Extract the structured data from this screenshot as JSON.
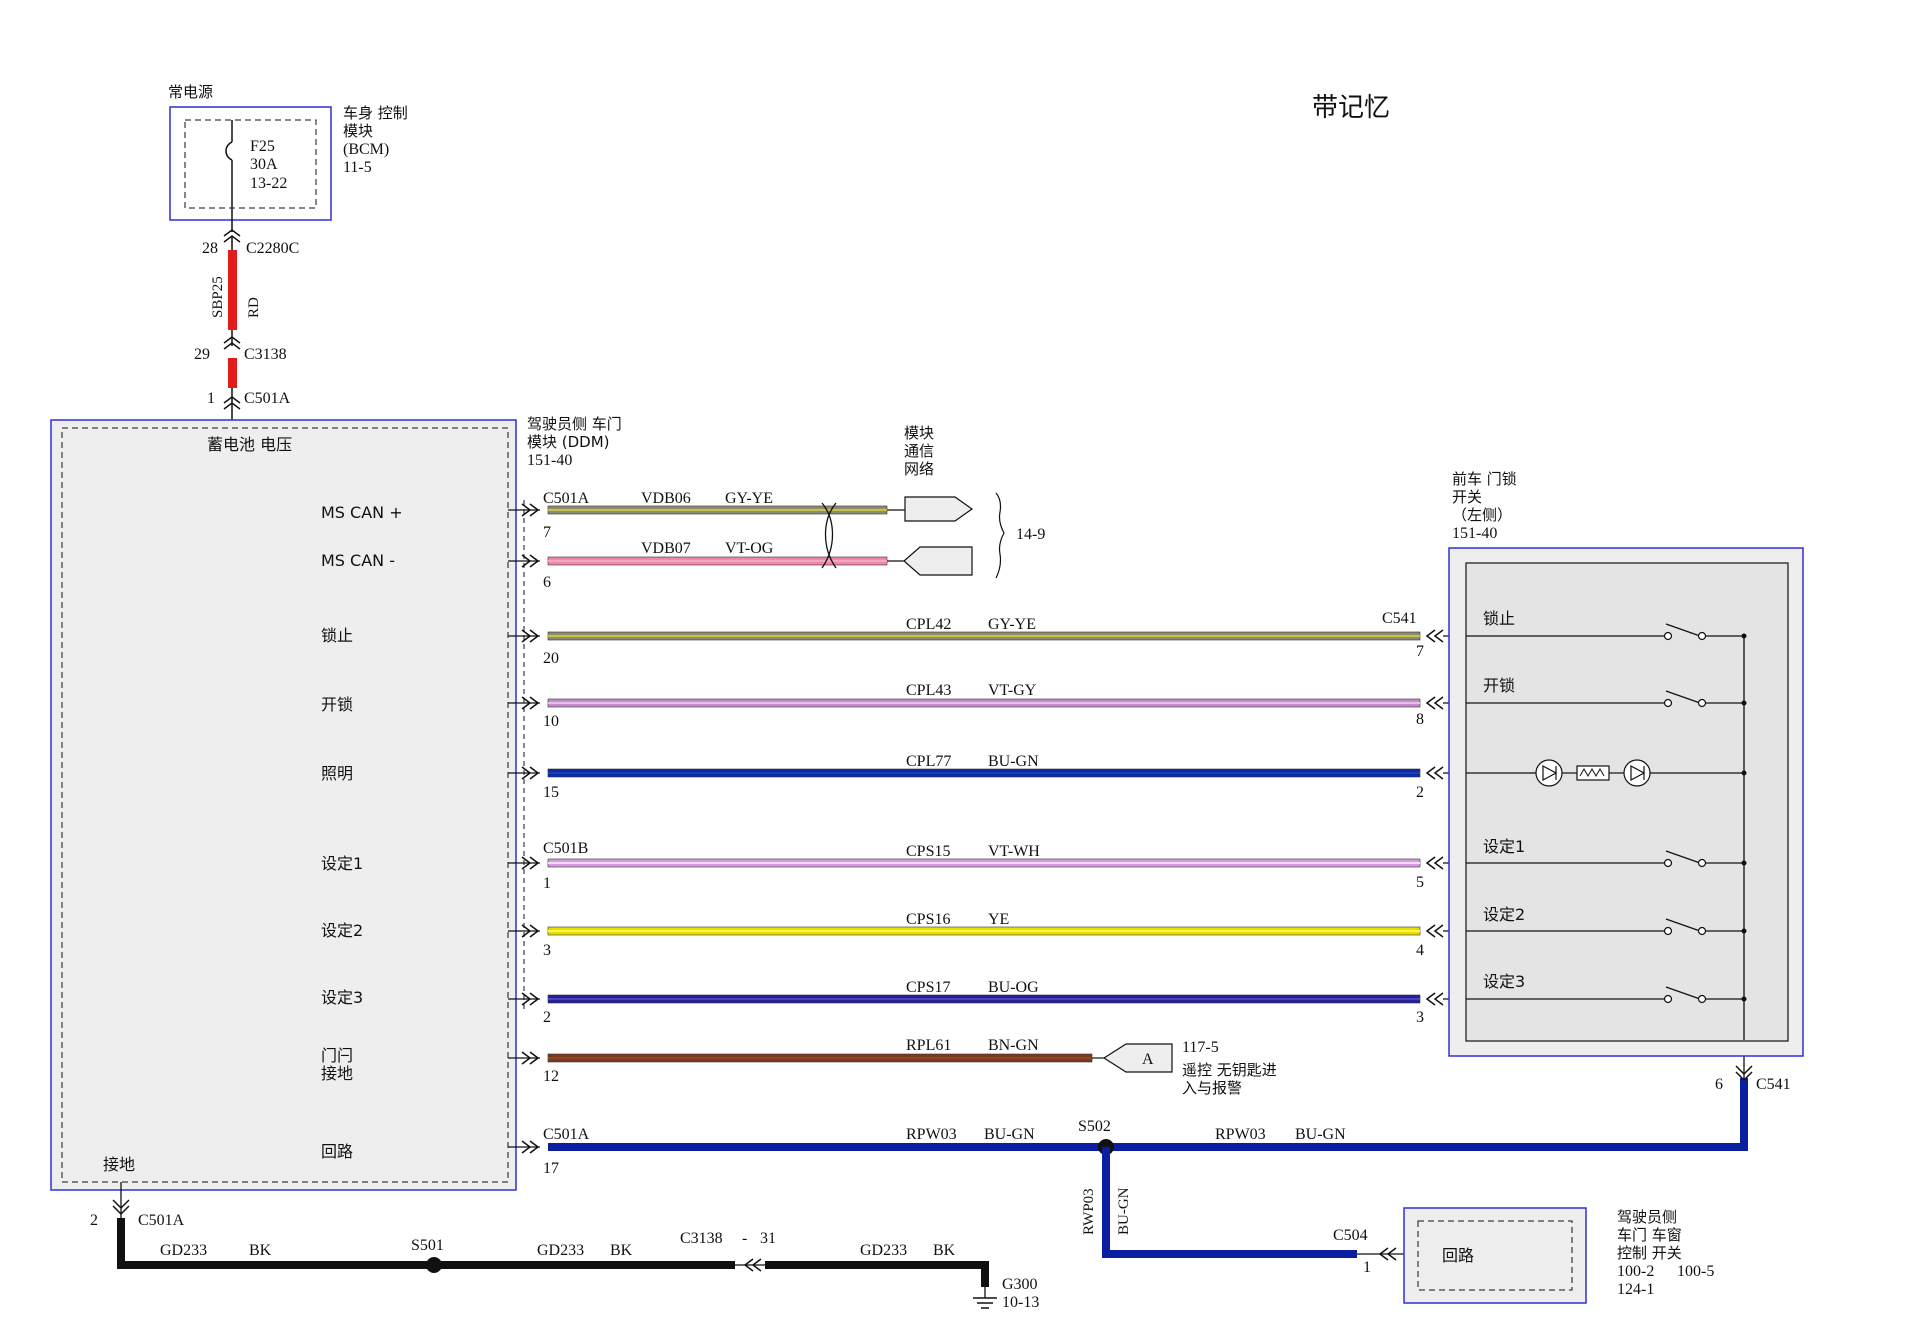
{
  "title": "带记忆",
  "colors": {
    "border": "#2e2edc",
    "box_fill": "#eeeeee",
    "inner_fill": "#e4e4e4",
    "red": "#e31b1b",
    "blue": "#0a1ea0",
    "black": "#111111",
    "gy_ye": [
      "#8c8c6e",
      "#c9c24a"
    ],
    "vt_og": [
      "#ee8aa8",
      "#f3a8c0"
    ],
    "vt_gy": [
      "#c58ac9",
      "#e2c4e6"
    ],
    "bu_gn": [
      "#0b2aa6",
      "#1a3fb8"
    ],
    "vt_wh": [
      "#d79be0",
      "#f2dcf5"
    ],
    "ye": [
      "#e6e000",
      "#fff544"
    ],
    "bu_og": [
      "#22209a",
      "#4d3fb8"
    ],
    "bn_gn": [
      "#7a3a1e",
      "#8a4a2a"
    ]
  },
  "power": {
    "label": "常电源",
    "fuse_name": "F25",
    "fuse_rating": "30A",
    "fuse_ref": "13-22",
    "bcm_line1": "车身 控制",
    "bcm_line2": "模块",
    "bcm_line3": "(BCM)",
    "bcm_ref": "11-5",
    "pin_top": "28",
    "conn_top": "C2280C",
    "wire_name": "SBP25",
    "wire_color": "RD",
    "pin_mid": "29",
    "conn_mid": "C3138",
    "pin_bottom": "1",
    "conn_bottom": "C501A"
  },
  "ddm": {
    "name_line1": "驾驶员侧 车门",
    "name_line2": "模块 (DDM)",
    "ref": "151-40",
    "battery_label": "蓄电池 电压",
    "ground_label": "接地",
    "pins": [
      {
        "label": "MS CAN +",
        "pin": "7",
        "conn": "C501A",
        "wire": "VDB06",
        "color": "GY-YE"
      },
      {
        "label": "MS CAN -",
        "pin": "6",
        "conn": "",
        "wire": "VDB07",
        "color": "VT-OG"
      },
      {
        "label": "锁止",
        "pin": "20",
        "conn": "",
        "wire": "CPL42",
        "color": "GY-YE",
        "far_pin": "7",
        "far_conn": "C541"
      },
      {
        "label": "开锁",
        "pin": "10",
        "conn": "",
        "wire": "CPL43",
        "color": "VT-GY",
        "far_pin": "8"
      },
      {
        "label": "照明",
        "pin": "15",
        "conn": "",
        "wire": "CPL77",
        "color": "BU-GN",
        "far_pin": "2"
      },
      {
        "label": "设定1",
        "pin": "1",
        "conn": "C501B",
        "wire": "CPS15",
        "color": "VT-WH",
        "far_pin": "5"
      },
      {
        "label": "设定2",
        "pin": "3",
        "conn": "",
        "wire": "CPS16",
        "color": "YE",
        "far_pin": "4"
      },
      {
        "label": "设定3",
        "pin": "2",
        "conn": "",
        "wire": "CPS17",
        "color": "BU-OG",
        "far_pin": "3"
      },
      {
        "label_line1": "门闩",
        "label_line2": "接地",
        "pin": "12",
        "wire": "RPL61",
        "color": "BN-GN"
      },
      {
        "label": "回路",
        "pin": "17",
        "conn": "C501A",
        "wire": "RPW03",
        "color": "BU-GN"
      }
    ]
  },
  "network": {
    "line1": "模块",
    "line2": "通信",
    "line3": "网络",
    "ref": "14-9"
  },
  "latch": {
    "tag": "A",
    "ref": "117-5",
    "line1": "遥控 无钥匙进",
    "line2": "入与报警"
  },
  "lock_switch": {
    "line1": "前车 门锁",
    "line2": "开关",
    "line3": "（左侧）",
    "ref": "151-40",
    "items": [
      "锁止",
      "开锁",
      "设定1",
      "设定2",
      "设定3"
    ],
    "out_pin": "6",
    "out_conn": "C541"
  },
  "return_circuit": {
    "splice": "S502",
    "wire_right": "RPW03",
    "color_right": "BU-GN",
    "wire_down": "RWP03",
    "color_down": "BU-GN",
    "conn": "C504",
    "pin": "1"
  },
  "window_switch": {
    "inner": "回路",
    "line1": "驾驶员侧",
    "line2": "车门 车窗",
    "line3": "控制 开关",
    "ref1": "100-2",
    "ref2": "100-5",
    "ref3": "124-1"
  },
  "ground": {
    "pin": "2",
    "conn": "C501A",
    "wire": "GD233",
    "color": "BK",
    "splice": "S501",
    "inline_conn": "C3138",
    "inline_dash": "-",
    "inline_pin": "31",
    "g_name": "G300",
    "g_ref": "10-13"
  }
}
